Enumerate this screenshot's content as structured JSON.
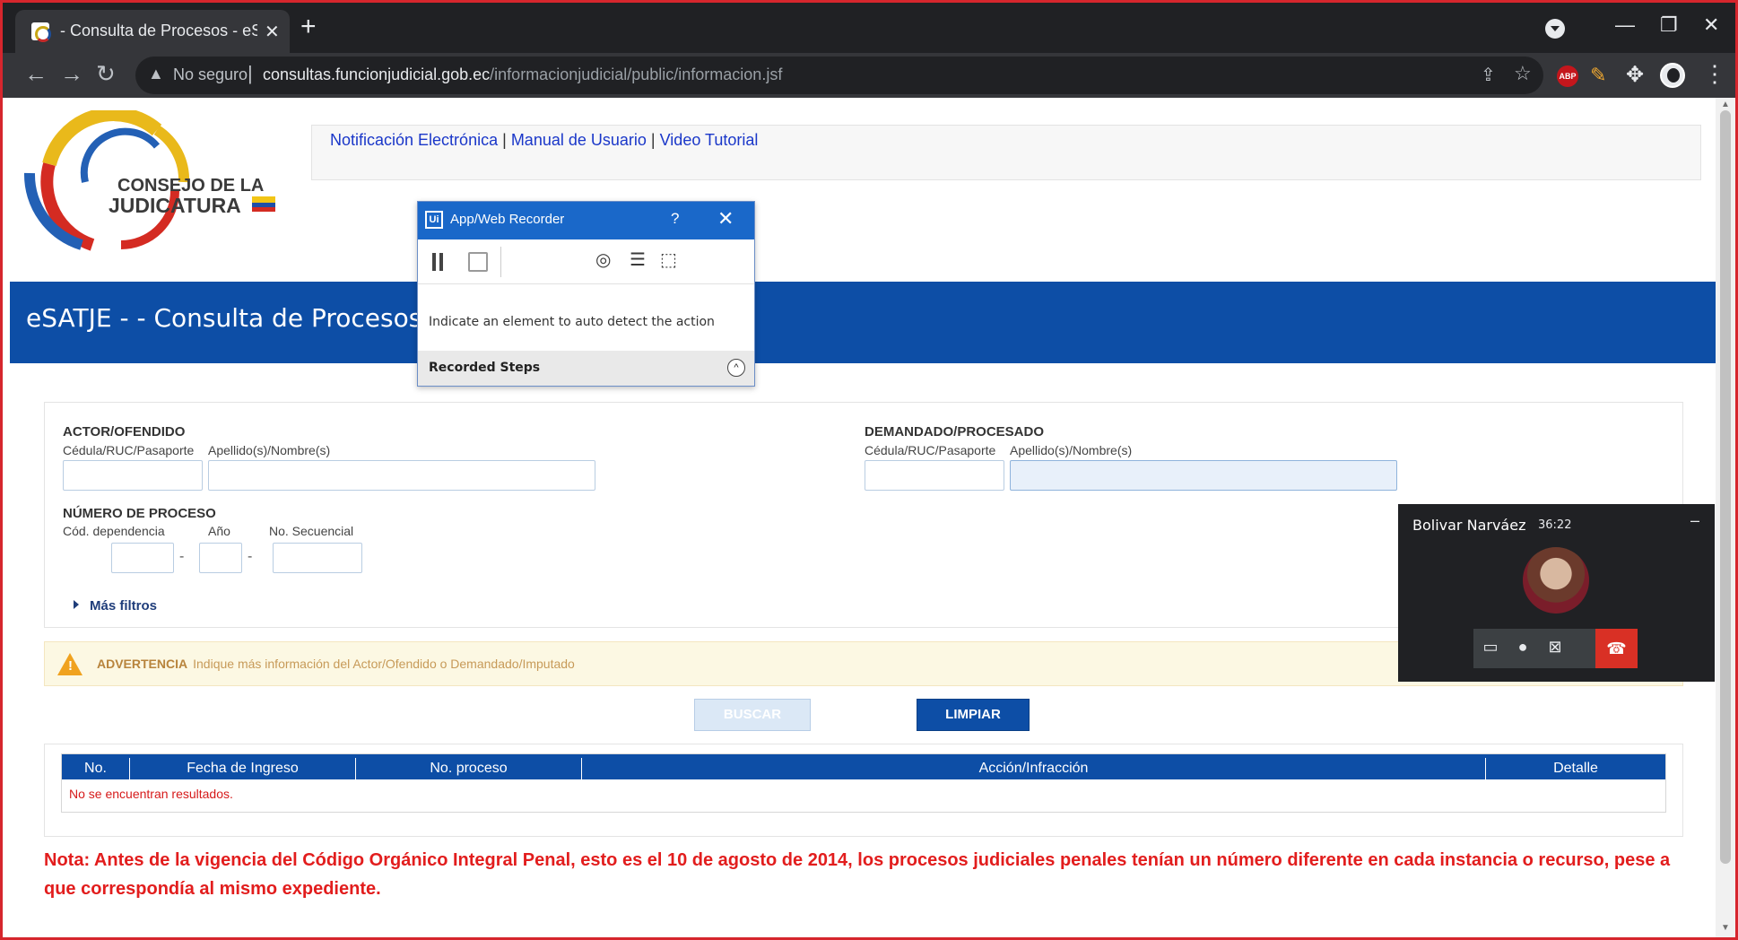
{
  "browser": {
    "tab_title": "- Consulta de Procesos - eSATJE",
    "tab_close": "✕",
    "new_tab": "+",
    "security_label": "No seguro",
    "url_domain": "consultas.funcionjudicial.gob.ec",
    "url_path": "/informacionjudicial/public/informacion.jsf",
    "ext_abp": "ABP",
    "icons": [
      "back-icon",
      "forward-icon",
      "reload-icon",
      "warning-icon",
      "share-icon",
      "star-icon",
      "puzzle-icon",
      "kebab-icon",
      "minimize-icon",
      "restore-icon",
      "close-icon"
    ]
  },
  "header": {
    "logo_line1": "CONSEJO DE LA",
    "logo_line2": "JUDICATURA",
    "links": [
      "Notificación Electrónica",
      "Manual de Usuario",
      "Video Tutorial"
    ],
    "separator": "|"
  },
  "banner": {
    "title": "eSATJE - - Consulta de Procesos"
  },
  "filters": {
    "actor_heading": "ACTOR/OFENDIDO",
    "actor_id_label": "Cédula/RUC/Pasaporte",
    "actor_name_label": "Apellido(s)/Nombre(s)",
    "demandado_heading": "DEMANDADO/PROCESADO",
    "demandado_id_label": "Cédula/RUC/Pasaporte",
    "demandado_name_label": "Apellido(s)/Nombre(s)",
    "numero_heading": "NÚMERO DE PROCESO",
    "cod_label": "Cód. dependencia",
    "anio_label": "Año",
    "secuencial_label": "No. Secuencial",
    "dash": "-",
    "mas_filtros": "Más filtros"
  },
  "warning": {
    "title": "ADVERTENCIA",
    "text": "Indique más información del Actor/Ofendido o Demandado/Imputado"
  },
  "buttons": {
    "buscar": "BUSCAR",
    "limpiar": "LIMPIAR"
  },
  "table": {
    "columns": [
      "No.",
      "Fecha de Ingreso",
      "No. proceso",
      "Acción/Infracción",
      "Detalle"
    ],
    "empty_message": "No se encuentran resultados."
  },
  "nota": "Nota: Antes de la vigencia del Código Orgánico Integral Penal, esto es el 10 de agosto de 2014, los procesos judiciales penales tenían un número diferente en cada instancia o recurso, pese a que correspondía al mismo expediente.",
  "recorder": {
    "logo": "Ui",
    "title": "App/Web Recorder",
    "help": "?",
    "close": "✕",
    "message": "Indicate an element to auto detect the action",
    "steps_label": "Recorded Steps",
    "chevron": "^"
  },
  "meet": {
    "name": "Bolivar Narváez",
    "time": "36:22",
    "minimize": "–"
  },
  "colors": {
    "brand_blue": "#0d4ea6",
    "alert_red": "#e21d1d",
    "chrome_dark": "#202124"
  }
}
